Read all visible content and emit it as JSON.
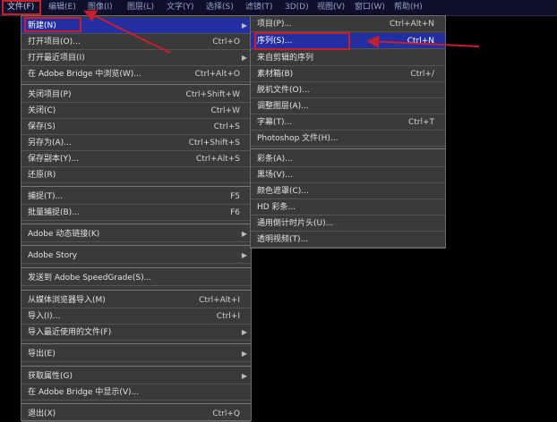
{
  "menubar": {
    "items": [
      "文件(F)",
      "编辑(E)",
      "图像(I)",
      "图层(L)",
      "文字(Y)",
      "选择(S)",
      "滤镜(T)",
      "3D(D)",
      "视图(V)",
      "窗口(W)",
      "帮助(H)"
    ]
  },
  "file_menu": {
    "items": [
      {
        "label": "新建(N)",
        "shortcut": "",
        "submenu": true
      },
      {
        "label": "打开项目(O)...",
        "shortcut": "Ctrl+O"
      },
      {
        "label": "打开最近项目(I)",
        "shortcut": "",
        "submenu": true
      },
      {
        "label": "在 Adobe Bridge 中浏览(W)...",
        "shortcut": "Ctrl+Alt+O"
      },
      {
        "label": "关闭项目(P)",
        "shortcut": "Ctrl+Shift+W"
      },
      {
        "label": "关闭(C)",
        "shortcut": "Ctrl+W"
      },
      {
        "label": "保存(S)",
        "shortcut": "Ctrl+S"
      },
      {
        "label": "另存为(A)...",
        "shortcut": "Ctrl+Shift+S"
      },
      {
        "label": "保存副本(Y)...",
        "shortcut": "Ctrl+Alt+S"
      },
      {
        "label": "还原(R)",
        "shortcut": ""
      },
      {
        "label": "捕捉(T)...",
        "shortcut": "F5"
      },
      {
        "label": "批量捕捉(B)...",
        "shortcut": "F6"
      },
      {
        "label": "Adobe 动态链接(K)",
        "shortcut": "",
        "submenu": true
      },
      {
        "label": "Adobe Story",
        "shortcut": "",
        "submenu": true
      },
      {
        "label": "发送到 Adobe SpeedGrade(S)...",
        "shortcut": ""
      },
      {
        "label": "从媒体浏览器导入(M)",
        "shortcut": "Ctrl+Alt+I"
      },
      {
        "label": "导入(I)...",
        "shortcut": "Ctrl+I"
      },
      {
        "label": "导入最近使用的文件(F)",
        "shortcut": "",
        "submenu": true
      },
      {
        "label": "导出(E)",
        "shortcut": "",
        "submenu": true
      },
      {
        "label": "获取属性(G)",
        "shortcut": "",
        "submenu": true
      },
      {
        "label": "在 Adobe Bridge 中显示(V)...",
        "shortcut": ""
      },
      {
        "label": "退出(X)",
        "shortcut": "Ctrl+Q"
      }
    ]
  },
  "new_submenu": {
    "items": [
      {
        "label": "项目(P)...",
        "shortcut": "Ctrl+Alt+N"
      },
      {
        "label": "序列(S)...",
        "shortcut": "Ctrl+N"
      },
      {
        "label": "来自剪辑的序列",
        "shortcut": ""
      },
      {
        "label": "素材箱(B)",
        "shortcut": "Ctrl+/"
      },
      {
        "label": "脱机文件(O)...",
        "shortcut": ""
      },
      {
        "label": "调整图层(A)...",
        "shortcut": ""
      },
      {
        "label": "字幕(T)...",
        "shortcut": "Ctrl+T"
      },
      {
        "label": "Photoshop 文件(H)...",
        "shortcut": ""
      },
      {
        "label": "彩条(A)...",
        "shortcut": ""
      },
      {
        "label": "黑场(V)...",
        "shortcut": ""
      },
      {
        "label": "颜色遮罩(C)...",
        "shortcut": ""
      },
      {
        "label": "HD 彩条...",
        "shortcut": ""
      },
      {
        "label": "通用倒计时片头(U)...",
        "shortcut": ""
      },
      {
        "label": "透明视频(T)...",
        "shortcut": ""
      }
    ]
  },
  "annotations": {
    "color": "#c81f2a"
  }
}
